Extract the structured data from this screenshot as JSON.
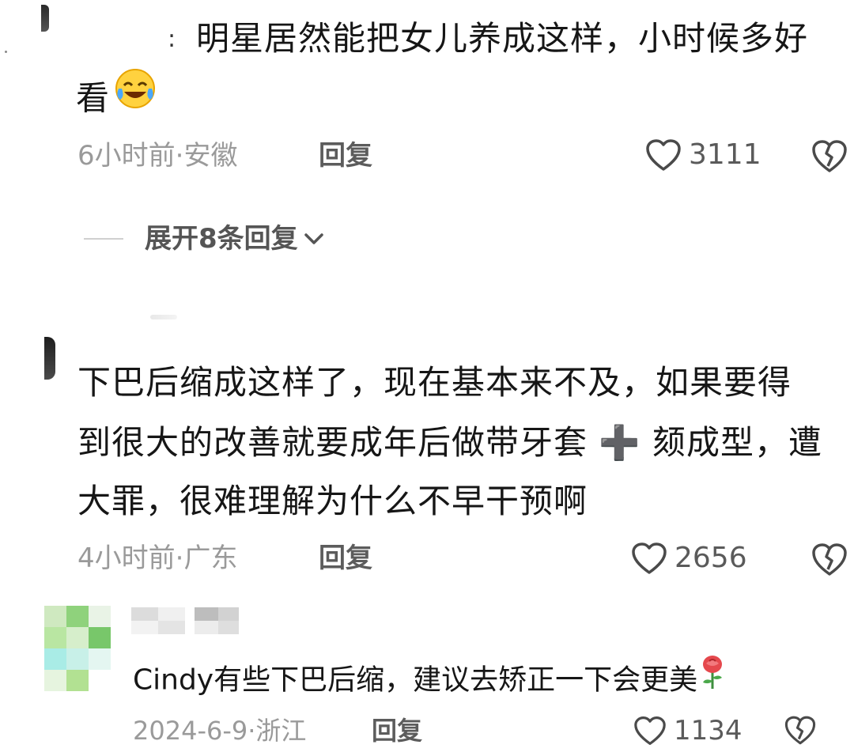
{
  "comments": [
    {
      "username_fragment": ":",
      "text_line1": "明星居然能把女儿养成这样，小时候多好",
      "text_line2": "看",
      "emoji": "laughing-with-tears-emoji",
      "meta": "6小时前·安徽",
      "reply_label": "回复",
      "likes": "3111",
      "expand_label": "展开8条回复"
    },
    {
      "text_line1": "下巴后缩成这样了，现在基本来不及，如果要得",
      "text_line2a": "到很大的改善就要成年后做带牙套",
      "plus": "➕",
      "text_line2b": "颏成型，遭",
      "text_line3": "大罪，很难理解为什么不早干预啊",
      "meta": "4小时前·广东",
      "reply_label": "回复",
      "likes": "2656"
    },
    {
      "text": "Cindy有些下巴后缩，建议去矫正一下会更美",
      "emoji": "rose-emoji",
      "meta": "2024-6-9·浙江",
      "reply_label": "回复",
      "likes": "1134"
    }
  ],
  "colors": {
    "text": "#161616",
    "meta": "#9a9a9a",
    "action": "#5a5a5a",
    "background": "#ffffff"
  },
  "icons": {
    "like": "heart-outline-icon",
    "dislike": "broken-heart-icon",
    "expand": "chevron-down-icon"
  }
}
